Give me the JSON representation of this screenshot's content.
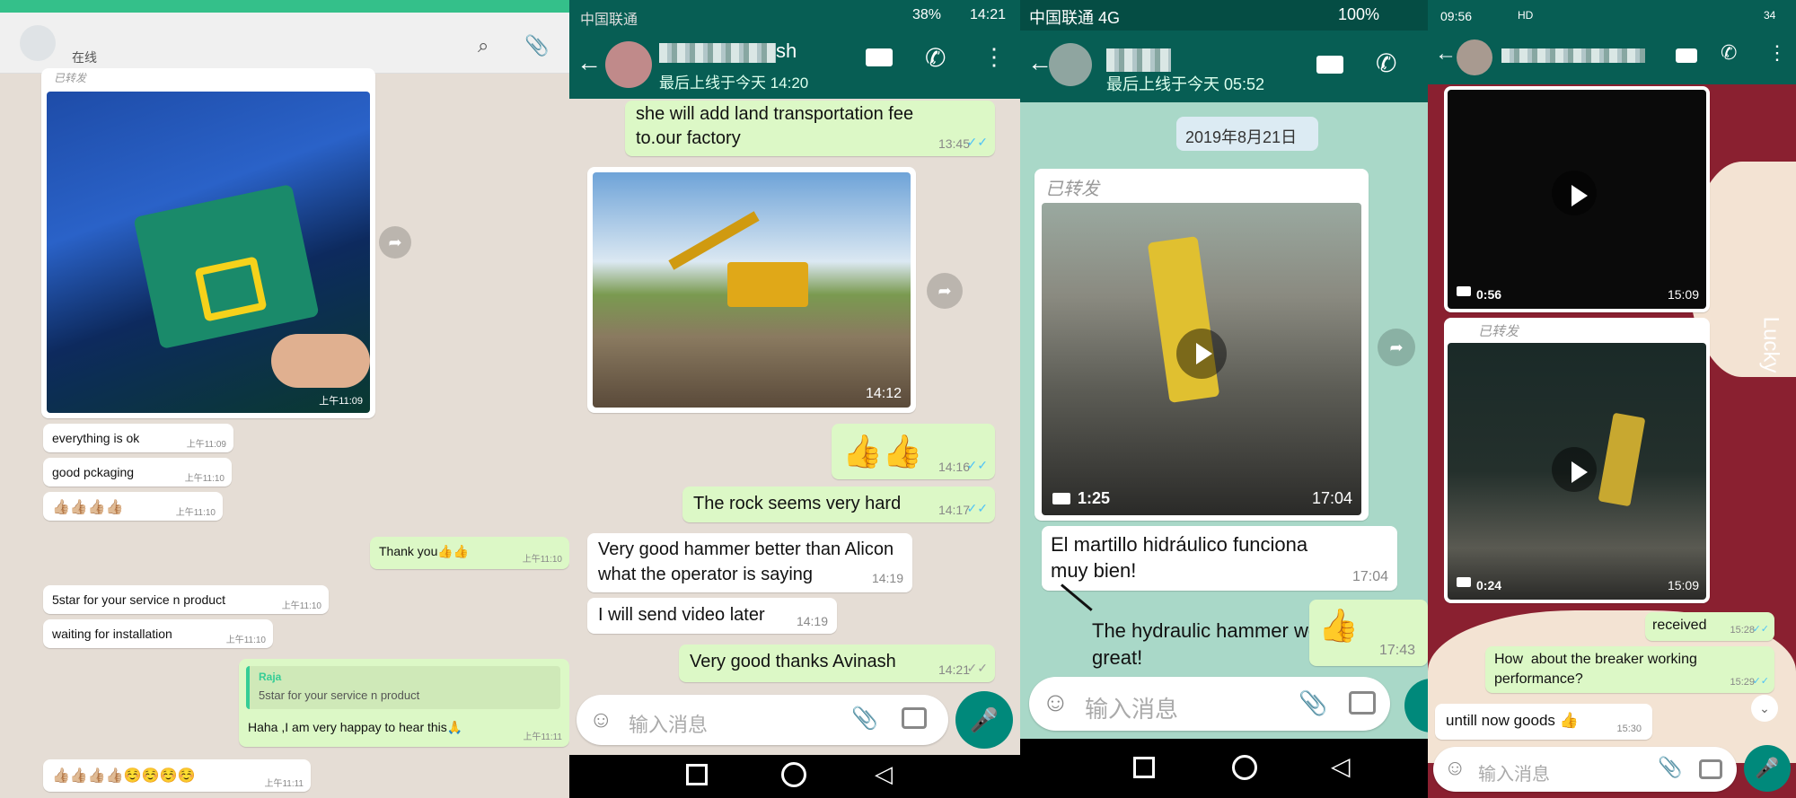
{
  "p1": {
    "status": "在线",
    "msgs": [
      {
        "text": "everything is ok",
        "time": "上午11:09"
      },
      {
        "text": "good pckaging",
        "time": "上午11:10"
      },
      {
        "text": "👍🏼👍🏼👍🏼👍🏼",
        "time": "上午11:10"
      },
      {
        "text": "Thank you👍👍",
        "time": "上午11:10"
      },
      {
        "text": "5star for your service n product",
        "time": "上午11:10"
      },
      {
        "text": "waiting for installation",
        "time": "上午11:10"
      },
      {
        "reply_author": "Raja",
        "reply_text": "5star for your service n product",
        "text": "Haha ,I am very happay to hear this🙏",
        "time": "上午11:11"
      },
      {
        "text": "👍🏼👍🏼👍🏼👍🏼☺️☺️☺️☺️",
        "time": "上午11:11"
      }
    ],
    "forwarded": "已转发",
    "image_time": "上午11:09"
  },
  "p2": {
    "carrier": "中国联通",
    "battery": "38%",
    "clock": "14:21",
    "contact": "sh",
    "last_seen": "最后上线于今天 14:20",
    "msgs": [
      {
        "text": "she will add land transportation fee\nto.our factory",
        "time": "13:45"
      },
      {
        "text": "👍👍",
        "time": "14:16"
      },
      {
        "text": "The rock seems very hard",
        "time": "14:17"
      },
      {
        "text": "Very good hammer better than Alicon\nwhat the operator is saying",
        "time": "14:19"
      },
      {
        "text": "I will send video later",
        "time": "14:19"
      },
      {
        "text": "Very good thanks Avinash",
        "time": "14:21"
      }
    ],
    "image_time": "14:12",
    "input_placeholder": "输入消息"
  },
  "p3": {
    "carrier": "中国联通 4G",
    "battery": "100%",
    "last_seen": "最后上线于今天 05:52",
    "date": "2019年8月21日",
    "forwarded": "已转发",
    "video_duration": "1:25",
    "video_time": "17:04",
    "msg": {
      "text": "El martillo hidráulico funciona\nmuy bien!",
      "time": "17:04"
    },
    "annotation": "The hydraulic hammer works\ngreat!",
    "thumb": {
      "text": "👍",
      "time": "17:43"
    },
    "input_placeholder": "输入消息"
  },
  "p4": {
    "clock": "09:56",
    "hd": "HD",
    "battery": "34",
    "video1": {
      "duration": "0:56",
      "time": "15:09"
    },
    "forwarded": "已转发",
    "video2": {
      "duration": "0:24",
      "time": "15:09"
    },
    "msgs": [
      {
        "text": "received",
        "time": "15:28"
      },
      {
        "text": "How  about the breaker working\nperformance?",
        "time": "15:29"
      },
      {
        "text": "untill now goods 👍",
        "time": "15:30"
      }
    ],
    "wallpaper_text": "Lucky",
    "input_placeholder": "输入消息"
  }
}
